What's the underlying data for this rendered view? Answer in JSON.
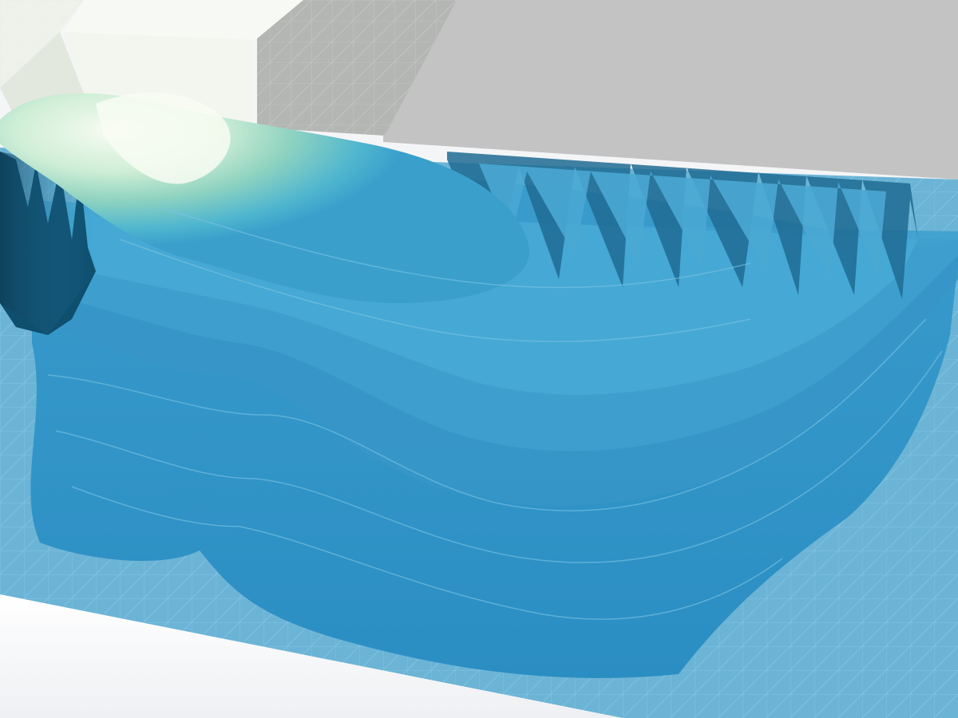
{
  "scene": {
    "colors": {
      "background": "#f4f5f7",
      "gray_block": "#c3c3c3",
      "gray_block_front": "#a9aaa9",
      "gray_block_side": "#b7b9b7",
      "white_block": "#f3f6ef",
      "white_block_side": "#e3e8df",
      "water_light": "#6cb4d6",
      "water_mid": "#3f9fcb",
      "water_deep": "#2a86b7",
      "water_dark": "#0f4f6e",
      "plume_core": "#f6fbf0",
      "plume_green": "#a8dcc0",
      "plume_teal": "#5fc2c9",
      "grid_line": "#8fd0ec"
    }
  }
}
